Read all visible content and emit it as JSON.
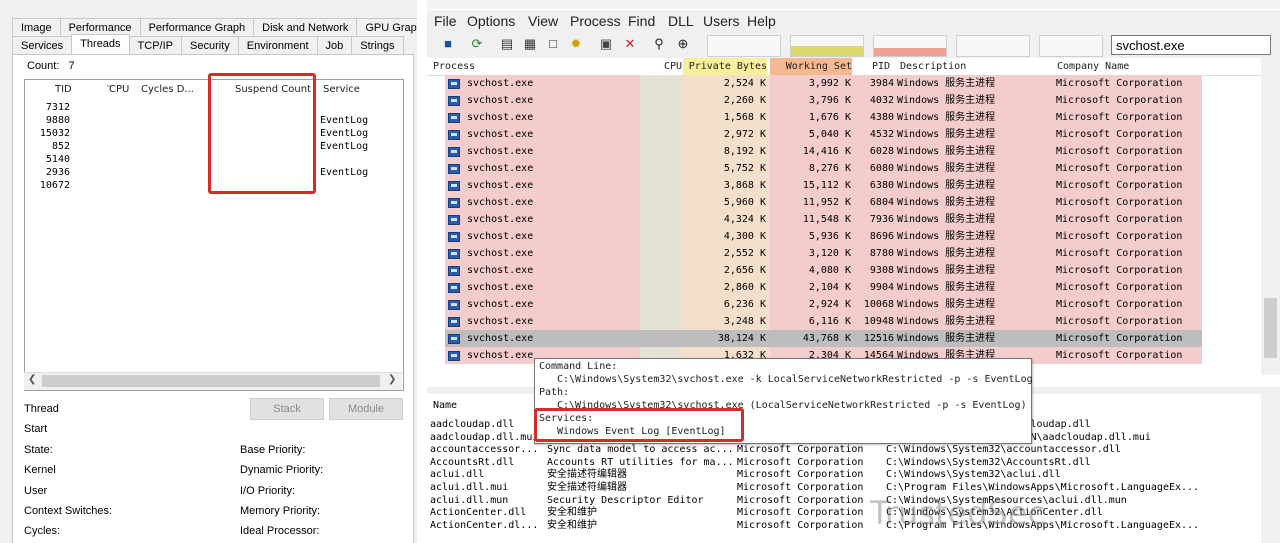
{
  "left_dialog": {
    "tabs_row1": [
      "Image",
      "Performance",
      "Performance Graph",
      "Disk and Network",
      "GPU Graph"
    ],
    "tabs_row2": [
      "Services",
      "Threads",
      "TCP/IP",
      "Security",
      "Environment",
      "Job",
      "Strings"
    ],
    "count_label": "Count:",
    "count_value": "7",
    "columns": [
      "TID",
      "CPU",
      "Cycles D...",
      "Suspend Count",
      "Service"
    ],
    "threads": [
      {
        "tid": "7312",
        "service": ""
      },
      {
        "tid": "9880",
        "service": "EventLog"
      },
      {
        "tid": "15032",
        "service": "EventLog"
      },
      {
        "tid": "852",
        "service": "EventLog"
      },
      {
        "tid": "5140",
        "service": ""
      },
      {
        "tid": "2936",
        "service": "EventLog"
      },
      {
        "tid": "10672",
        "service": ""
      }
    ],
    "stack_button": "Stack",
    "module_button": "Module",
    "labels_left": [
      "Thread",
      "Start",
      "State:",
      "Kernel",
      "User",
      "Context Switches:",
      "Cycles:"
    ],
    "labels_right": [
      "Base Priority:",
      "Dynamic Priority:",
      "I/O Priority:",
      "Memory Priority:",
      "Ideal Processor:"
    ]
  },
  "process_explorer": {
    "menu": [
      "File",
      "Options",
      "View",
      "Process",
      "Find",
      "DLL",
      "Users",
      "Help"
    ],
    "search_value": "svchost.exe",
    "columns": [
      "Process",
      "CPU",
      "Private Bytes",
      "Working Set",
      "PID",
      "Description",
      "Company Name"
    ],
    "processes": [
      {
        "name": "svchost.exe",
        "private": "2,524 K",
        "working": "3,992 K",
        "pid": "3984",
        "desc": "Windows 服务主进程",
        "company": "Microsoft Corporation"
      },
      {
        "name": "svchost.exe",
        "private": "2,260 K",
        "working": "3,796 K",
        "pid": "4032",
        "desc": "Windows 服务主进程",
        "company": "Microsoft Corporation"
      },
      {
        "name": "svchost.exe",
        "private": "1,568 K",
        "working": "1,676 K",
        "pid": "4380",
        "desc": "Windows 服务主进程",
        "company": "Microsoft Corporation"
      },
      {
        "name": "svchost.exe",
        "private": "2,972 K",
        "working": "5,040 K",
        "pid": "4532",
        "desc": "Windows 服务主进程",
        "company": "Microsoft Corporation"
      },
      {
        "name": "svchost.exe",
        "private": "8,192 K",
        "working": "14,416 K",
        "pid": "6028",
        "desc": "Windows 服务主进程",
        "company": "Microsoft Corporation"
      },
      {
        "name": "svchost.exe",
        "private": "5,752 K",
        "working": "8,276 K",
        "pid": "6080",
        "desc": "Windows 服务主进程",
        "company": "Microsoft Corporation"
      },
      {
        "name": "svchost.exe",
        "private": "3,868 K",
        "working": "15,112 K",
        "pid": "6380",
        "desc": "Windows 服务主进程",
        "company": "Microsoft Corporation"
      },
      {
        "name": "svchost.exe",
        "private": "5,960 K",
        "working": "11,952 K",
        "pid": "6804",
        "desc": "Windows 服务主进程",
        "company": "Microsoft Corporation"
      },
      {
        "name": "svchost.exe",
        "private": "4,324 K",
        "working": "11,548 K",
        "pid": "7936",
        "desc": "Windows 服务主进程",
        "company": "Microsoft Corporation"
      },
      {
        "name": "svchost.exe",
        "private": "4,300 K",
        "working": "5,936 K",
        "pid": "8696",
        "desc": "Windows 服务主进程",
        "company": "Microsoft Corporation"
      },
      {
        "name": "svchost.exe",
        "private": "2,552 K",
        "working": "3,120 K",
        "pid": "8780",
        "desc": "Windows 服务主进程",
        "company": "Microsoft Corporation"
      },
      {
        "name": "svchost.exe",
        "private": "2,656 K",
        "working": "4,080 K",
        "pid": "9308",
        "desc": "Windows 服务主进程",
        "company": "Microsoft Corporation"
      },
      {
        "name": "svchost.exe",
        "private": "2,860 K",
        "working": "2,104 K",
        "pid": "9904",
        "desc": "Windows 服务主进程",
        "company": "Microsoft Corporation"
      },
      {
        "name": "svchost.exe",
        "private": "6,236 K",
        "working": "2,924 K",
        "pid": "10068",
        "desc": "Windows 服务主进程",
        "company": "Microsoft Corporation"
      },
      {
        "name": "svchost.exe",
        "private": "3,248 K",
        "working": "6,116 K",
        "pid": "10948",
        "desc": "Windows 服务主进程",
        "company": "Microsoft Corporation"
      },
      {
        "name": "svchost.exe",
        "private": "38,124 K",
        "working": "43,768 K",
        "pid": "12516",
        "desc": "Windows 服务主进程",
        "company": "Microsoft Corporation",
        "selected": true
      },
      {
        "name": "svchost.exe",
        "private": "1,632 K",
        "working": "2,304 K",
        "pid": "14564",
        "desc": "Windows 服务主进程",
        "company": "Microsoft Corporation"
      }
    ],
    "tooltip": {
      "cmd_label": "Command Line:",
      "cmd_value": "C:\\Windows\\System32\\svchost.exe -k LocalServiceNetworkRestricted -p -s EventLog",
      "path_label": "Path:",
      "path_value": "C:\\Windows\\System32\\svchost.exe (LocalServiceNetworkRestricted -p -s EventLog)",
      "services_label": "Services:",
      "services_value": "Windows Event Log [EventLog]"
    },
    "dll_header_name": "Name",
    "dlls": [
      {
        "name": "aadcloudap.dll",
        "desc": "",
        "company": "",
        "path": "C:\\Windows\\System32\\aadcloudap.dll"
      },
      {
        "name": "aadcloudap.dll.mui",
        "desc": "",
        "company": "",
        "path": "C:\\Windows\\System32\\zh-CN\\aadcloudap.dll.mui"
      },
      {
        "name": "accountaccessor...",
        "desc": "Sync data model to access ac...",
        "company": "Microsoft Corporation",
        "path": "C:\\Windows\\System32\\accountaccessor.dll"
      },
      {
        "name": "AccountsRt.dll",
        "desc": "Accounts RT utilities for ma...",
        "company": "Microsoft Corporation",
        "path": "C:\\Windows\\System32\\AccountsRt.dll"
      },
      {
        "name": "aclui.dll",
        "desc": "安全描述符编辑器",
        "company": "Microsoft Corporation",
        "path": "C:\\Windows\\System32\\aclui.dll"
      },
      {
        "name": "aclui.dll.mui",
        "desc": "安全描述符编辑器",
        "company": "Microsoft Corporation",
        "path": "C:\\Program Files\\WindowsApps\\Microsoft.LanguageEx..."
      },
      {
        "name": "aclui.dll.mun",
        "desc": "Security Descriptor Editor",
        "company": "Microsoft Corporation",
        "path": "C:\\Windows\\SystemResources\\aclui.dll.mun"
      },
      {
        "name": "ActionCenter.dll",
        "desc": "安全和维护",
        "company": "Microsoft Corporation",
        "path": "C:\\Windows\\System32\\ActionCenter.dll"
      },
      {
        "name": "ActionCenter.dl...",
        "desc": "安全和维护",
        "company": "Microsoft Corporation",
        "path": "C:\\Program Files\\WindowsApps\\Microsoft.LanguageEx..."
      }
    ]
  },
  "watermark": "TrustedSec",
  "colors": {
    "service_row": "#f5cccc",
    "selected_row": "#bdbdbd",
    "highlight": "#d62b2b",
    "private_bytes_header": "#f7ef9a",
    "working_set_header": "#f4b990"
  }
}
